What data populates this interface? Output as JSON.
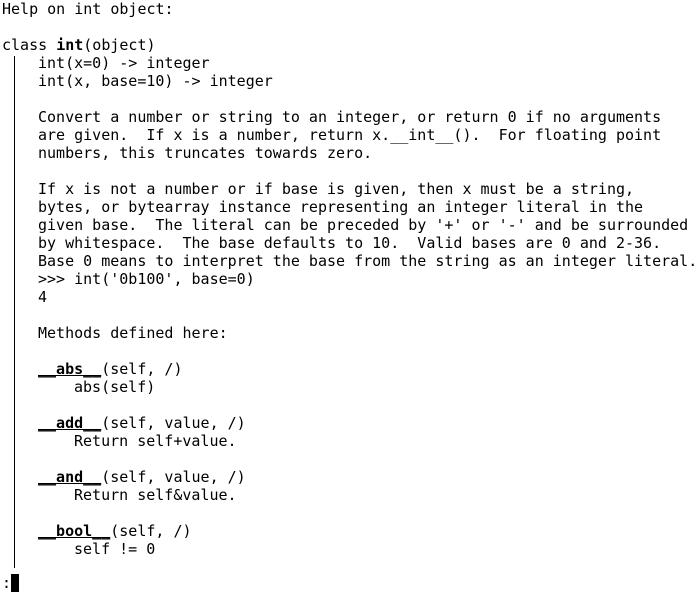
{
  "window": {
    "header": "Help on int object:"
  },
  "class_decl": {
    "prefix": "class ",
    "name": "int",
    "suffix": "(object)"
  },
  "signatures": [
    "int(x=0) -> integer",
    "int(x, base=10) -> integer"
  ],
  "doc_paragraph_1": [
    "Convert a number or string to an integer, or return 0 if no arguments",
    "are given.  If x is a number, return x.__int__().  For floating point",
    "numbers, this truncates towards zero."
  ],
  "doc_paragraph_2": [
    "If x is not a number or if base is given, then x must be a string,",
    "bytes, or bytearray instance representing an integer literal in the",
    "given base.  The literal can be preceded by '+' or '-' and be surrounded",
    "by whitespace.  The base defaults to 10.  Valid bases are 0 and 2-36.",
    "Base 0 means to interpret the base from the string as an integer literal."
  ],
  "example": {
    "input": ">>> int('0b100', base=0)",
    "output": "4"
  },
  "methods_heading": "Methods defined here:",
  "methods": [
    {
      "name": "__abs__",
      "args": "(self, /)",
      "doc": "abs(self)"
    },
    {
      "name": "__add__",
      "args": "(self, value, /)",
      "doc": "Return self+value."
    },
    {
      "name": "__and__",
      "args": "(self, value, /)",
      "doc": "Return self&value."
    },
    {
      "name": "__bool__",
      "args": "(self, /)",
      "doc": "self != 0"
    }
  ],
  "pager": {
    "prompt": ":"
  }
}
